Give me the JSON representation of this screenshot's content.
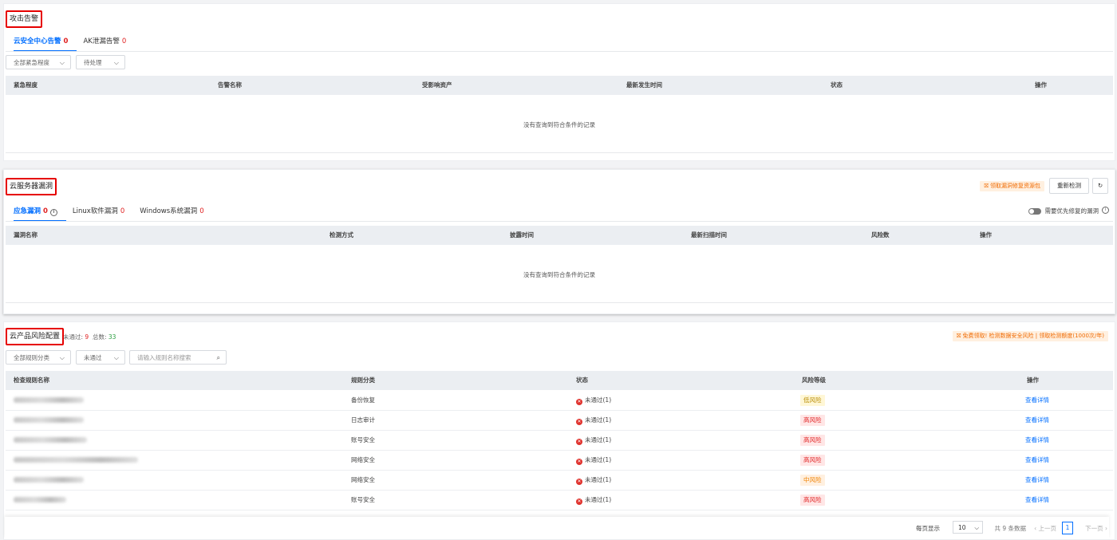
{
  "attack_alerts": {
    "title": "攻击告警",
    "tabs": [
      {
        "label": "云安全中心告警",
        "count": "0"
      },
      {
        "label": "AK泄漏告警",
        "count": "0"
      }
    ],
    "filters": [
      "全部紧急程度",
      "待处理"
    ],
    "columns": [
      "紧急程度",
      "告警名称",
      "受影响资产",
      "最新发生时间",
      "状态",
      "操作"
    ],
    "empty_text": "没有查询到符合条件的记录"
  },
  "vulns": {
    "title": "云服务器漏洞",
    "get_pack_label": "领取漏洞修复资源包",
    "recheck_label": "重新检测",
    "tabs": [
      {
        "label": "应急漏洞",
        "count": "0"
      },
      {
        "label": "Linux软件漏洞",
        "count": "0"
      },
      {
        "label": "Windows系统漏洞",
        "count": "0"
      }
    ],
    "priority_toggle_label": "需要优先修复的漏洞",
    "columns": [
      "漏洞名称",
      "检测方式",
      "披露时间",
      "最新扫描时间",
      "风险数",
      "操作"
    ],
    "empty_text": "没有查询到符合条件的记录"
  },
  "cloud_config": {
    "title": "云产品风险配置",
    "failed_label": "未通过:",
    "failed_count": "9",
    "total_label": "总数:",
    "total_count": "33",
    "promo": "免费领取! 检测数据安全风险 | 领取检测额度(1000次/年)",
    "filters": [
      "全部规则分类",
      "未通过"
    ],
    "search_placeholder": "请输入规则名称搜索",
    "columns": [
      "检查规则名称",
      "规则分类",
      "状态",
      "风险等级",
      "操作"
    ],
    "rows": [
      {
        "category": "备份恢复",
        "status": "未通过(1)",
        "risk": "低风险",
        "risk_level": "low",
        "action": "查看详情"
      },
      {
        "category": "日志审计",
        "status": "未通过(1)",
        "risk": "高风险",
        "risk_level": "high",
        "action": "查看详情"
      },
      {
        "category": "账号安全",
        "status": "未通过(1)",
        "risk": "高风险",
        "risk_level": "high",
        "action": "查看详情"
      },
      {
        "category": "网络安全",
        "status": "未通过(1)",
        "risk": "高风险",
        "risk_level": "high",
        "action": "查看详情"
      },
      {
        "category": "网络安全",
        "status": "未通过(1)",
        "risk": "中风险",
        "risk_level": "mid",
        "action": "查看详情"
      },
      {
        "category": "账号安全",
        "status": "未通过(1)",
        "risk": "高风险",
        "risk_level": "high",
        "action": "查看详情"
      }
    ],
    "pagination": {
      "per_page_label": "每页显示",
      "per_page": "10",
      "total_text": "共 9 条数据",
      "prev": "上一页",
      "page": "1",
      "next": "下一页"
    }
  }
}
